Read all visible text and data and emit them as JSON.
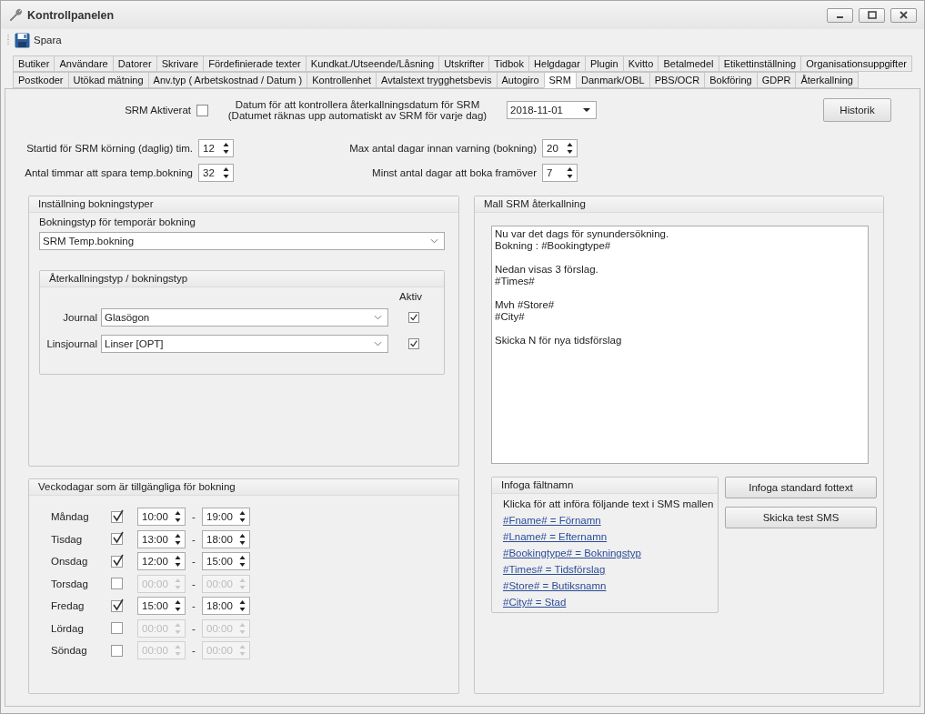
{
  "window": {
    "title": "Kontrollpanelen"
  },
  "toolbar": {
    "save_label": "Spara"
  },
  "tab_rows": [
    [
      {
        "label": "Butiker",
        "selected": false
      },
      {
        "label": "Användare",
        "selected": false
      },
      {
        "label": "Datorer",
        "selected": false
      },
      {
        "label": "Skrivare",
        "selected": false
      },
      {
        "label": "Fördefinierade texter",
        "selected": false
      },
      {
        "label": "Kundkat./Utseende/Låsning",
        "selected": false
      },
      {
        "label": "Utskrifter",
        "selected": false
      },
      {
        "label": "Tidbok",
        "selected": false
      },
      {
        "label": "Helgdagar",
        "selected": false
      },
      {
        "label": "Plugin",
        "selected": false
      },
      {
        "label": "Kvitto",
        "selected": false
      },
      {
        "label": "Betalmedel",
        "selected": false
      },
      {
        "label": "Etikettinställning",
        "selected": false
      },
      {
        "label": "Organisationsuppgifter",
        "selected": false
      }
    ],
    [
      {
        "label": "Postkoder",
        "selected": false
      },
      {
        "label": "Utökad mätning",
        "selected": false
      },
      {
        "label": "Anv.typ ( Arbetskostnad / Datum )",
        "selected": false
      },
      {
        "label": "Kontrollenhet",
        "selected": false
      },
      {
        "label": "Avtalstext trygghetsbevis",
        "selected": false
      },
      {
        "label": "Autogiro",
        "selected": false
      },
      {
        "label": "SRM",
        "selected": true
      },
      {
        "label": "Danmark/OBL",
        "selected": false
      },
      {
        "label": "PBS/OCR",
        "selected": false
      },
      {
        "label": "Bokföring",
        "selected": false
      },
      {
        "label": "GDPR",
        "selected": false
      },
      {
        "label": "Återkallning",
        "selected": false
      }
    ]
  ],
  "srm_active": {
    "label": "SRM Aktiverat",
    "checked": false
  },
  "check_date": {
    "label": "Datum för att kontrollera återkallningsdatum för SRM",
    "note": "(Datumet räknas upp automatiskt av SRM för varje dag)",
    "value": "2018-11-01"
  },
  "history_button": "Historik",
  "start_time": {
    "label": "Startid för SRM körning (daglig) tim.",
    "value": "12"
  },
  "hours_temp": {
    "label": "Antal timmar att spara temp.bokning",
    "value": "32"
  },
  "max_days": {
    "label": "Max antal dagar innan varning (bokning)",
    "value": "20"
  },
  "min_days": {
    "label": "Minst antal dagar att boka framöver",
    "value": "7"
  },
  "booking_types": {
    "title": "Inställning bokningstyper",
    "temp_label": "Bokningstyp för temporär bokning",
    "temp_value": "SRM Temp.bokning",
    "recall": {
      "title": "Återkallningstyp / bokningstyp",
      "active_label": "Aktiv",
      "rows": [
        {
          "label": "Journal",
          "value": "Glasögon",
          "checked": true
        },
        {
          "label": "Linsjournal",
          "value": "Linser [OPT]",
          "checked": true
        }
      ]
    }
  },
  "weekdays": {
    "title": "Veckodagar som är tillgängliga för bokning",
    "separator": "-",
    "days": [
      {
        "name": "Måndag",
        "checked": true,
        "from": "10:00",
        "to": "19:00"
      },
      {
        "name": "Tisdag",
        "checked": true,
        "from": "13:00",
        "to": "18:00"
      },
      {
        "name": "Onsdag",
        "checked": true,
        "from": "12:00",
        "to": "15:00"
      },
      {
        "name": "Torsdag",
        "checked": false,
        "from": "00:00",
        "to": "00:00"
      },
      {
        "name": "Fredag",
        "checked": true,
        "from": "15:00",
        "to": "18:00"
      },
      {
        "name": "Lördag",
        "checked": false,
        "from": "00:00",
        "to": "00:00"
      },
      {
        "name": "Söndag",
        "checked": false,
        "from": "00:00",
        "to": "00:00"
      }
    ]
  },
  "template": {
    "title": "Mall SRM återkallning",
    "text": "Nu var det dags för synundersökning.\nBokning : #Bookingtype#\n\nNedan visas 3 förslag.\n#Times#\n\nMvh #Store#\n#City#\n\nSkicka N för nya tidsförslag"
  },
  "fields": {
    "title": "Infoga fältnamn",
    "hint": "Klicka för att införa följande text i SMS mallen",
    "links": [
      "#Fname# = Förnamn",
      "#Lname# = Efternamn",
      "#Bookingtype# = Bokningstyp",
      "#Times# = Tidsförslag",
      "#Store# =  Butiksnamn",
      "#City# =  Stad"
    ]
  },
  "template_buttons": [
    "Infoga standard fottext",
    "Skicka test SMS"
  ]
}
